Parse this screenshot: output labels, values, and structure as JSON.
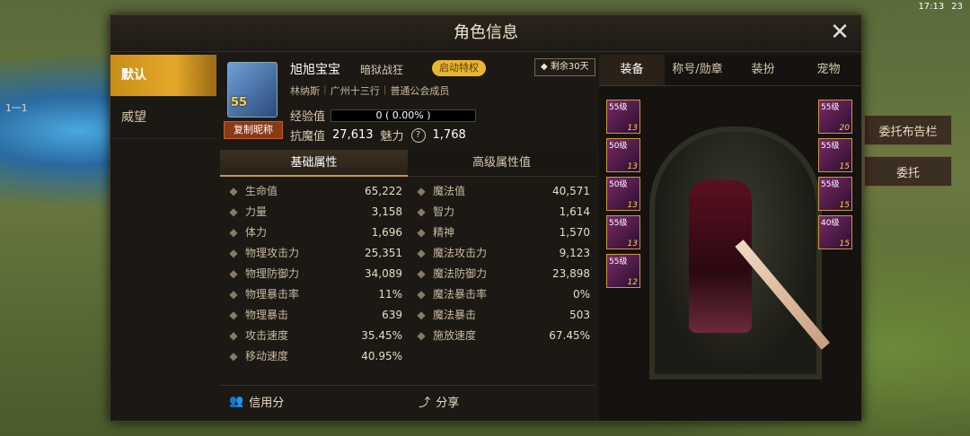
{
  "background": {
    "status": "17:13",
    "battery": "23",
    "side_button_1": "委托布告栏",
    "side_button_2": "委托",
    "left_tag": "1一1"
  },
  "dialog": {
    "title": "角色信息",
    "left_tabs": [
      "默认",
      "威望"
    ],
    "character": {
      "name": "旭旭宝宝",
      "job": "暗狱战狂",
      "privilege": "启动特权",
      "level": "55",
      "copy_button": "复制昵称",
      "region": "林纳斯",
      "guild": "广州十三行",
      "guild_rank": "普通公会成员",
      "remaining": "剩余30天",
      "exp_label": "经验值",
      "exp_value": "0 ( 0.00% )",
      "exp_fraction": 0.0,
      "resist_label": "抗魔值",
      "resist_value": "27,613",
      "charm_label": "魅力",
      "charm_value": "1,768"
    },
    "attr_tabs": [
      "基础属性",
      "高级属性值"
    ],
    "attributes": [
      [
        {
          "label": "生命值",
          "value": "65,222",
          "icon": "heart-icon"
        },
        {
          "label": "魔法值",
          "value": "40,571",
          "icon": "heart-outline-icon"
        }
      ],
      [
        {
          "label": "力量",
          "value": "3,158",
          "icon": "fist-icon"
        },
        {
          "label": "智力",
          "value": "1,614",
          "icon": "brain-icon"
        }
      ],
      [
        {
          "label": "体力",
          "value": "1,696",
          "icon": "runner-icon"
        },
        {
          "label": "精神",
          "value": "1,570",
          "icon": "circle-icon"
        }
      ],
      [
        {
          "label": "物理攻击力",
          "value": "25,351",
          "icon": "sword-icon"
        },
        {
          "label": "魔法攻击力",
          "value": "9,123",
          "icon": "sparkle-icon"
        }
      ],
      [
        {
          "label": "物理防御力",
          "value": "34,089",
          "icon": "shield-icon"
        },
        {
          "label": "魔法防御力",
          "value": "23,898",
          "icon": "yinyang-icon"
        }
      ],
      [
        {
          "label": "物理暴击率",
          "value": "11%",
          "icon": "target-icon"
        },
        {
          "label": "魔法暴击率",
          "value": "0%",
          "icon": "target-icon"
        }
      ],
      [
        {
          "label": "物理暴击",
          "value": "639",
          "icon": "target-icon"
        },
        {
          "label": "魔法暴击",
          "value": "503",
          "icon": "target-icon"
        }
      ],
      [
        {
          "label": "攻击速度",
          "value": "35.45%",
          "icon": "blade-icon"
        },
        {
          "label": "施放速度",
          "value": "67.45%",
          "icon": "hand-icon"
        }
      ],
      [
        {
          "label": "移动速度",
          "value": "40.95%",
          "icon": "boot-icon"
        },
        {
          "label": "",
          "value": "",
          "icon": ""
        }
      ]
    ],
    "bottom": {
      "credit": "信用分",
      "share": "分享"
    },
    "equip_tabs": [
      "装备",
      "称号/勋章",
      "装扮",
      "宠物"
    ],
    "slots_left": [
      {
        "lv": "55级",
        "num": "13"
      },
      {
        "lv": "50级",
        "num": "13"
      },
      {
        "lv": "50级",
        "num": "13"
      },
      {
        "lv": "55级",
        "num": "13"
      },
      {
        "lv": "55级",
        "num": "12"
      }
    ],
    "slots_right": [
      {
        "lv": "55级",
        "num": "20"
      },
      {
        "lv": "55级",
        "num": "15"
      },
      {
        "lv": "55级",
        "num": "15"
      },
      {
        "lv": "40级",
        "num": "15"
      }
    ]
  }
}
